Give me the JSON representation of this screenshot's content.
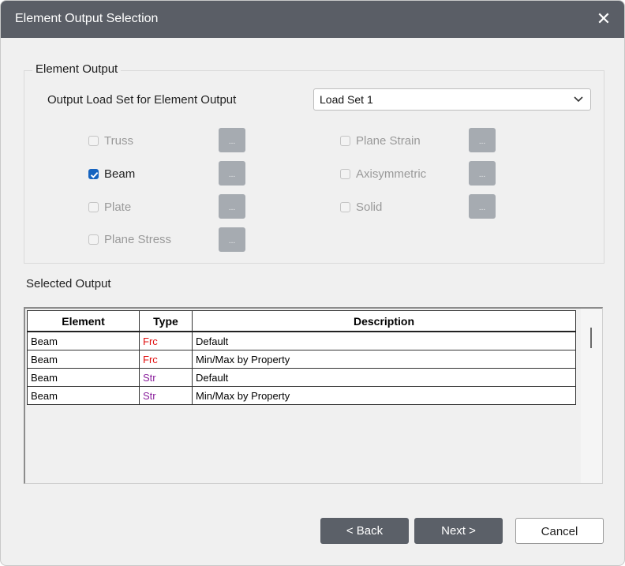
{
  "window": {
    "title": "Element Output Selection",
    "close_glyph": "✕"
  },
  "group": {
    "title": "Element Output",
    "load_set_label": "Output Load Set for Element Output",
    "load_set_value": "Load Set 1"
  },
  "elements": {
    "truss": {
      "label": "Truss",
      "checked": false,
      "enabled": false
    },
    "beam": {
      "label": "Beam",
      "checked": true,
      "enabled": true
    },
    "plate": {
      "label": "Plate",
      "checked": false,
      "enabled": false
    },
    "plane_stress": {
      "label": "Plane Stress",
      "checked": false,
      "enabled": false
    },
    "plane_strain": {
      "label": "Plane Strain",
      "checked": false,
      "enabled": false
    },
    "axisymmetric": {
      "label": "Axisymmetric",
      "checked": false,
      "enabled": false
    },
    "solid": {
      "label": "Solid",
      "checked": false,
      "enabled": false
    }
  },
  "dots_label": "...",
  "selected_output": {
    "label": "Selected Output",
    "columns": [
      "Element",
      "Type",
      "Description"
    ],
    "rows": [
      [
        "Beam",
        "Frc",
        "Default"
      ],
      [
        "Beam",
        "Frc",
        "Min/Max by Property"
      ],
      [
        "Beam",
        "Str",
        "Default"
      ],
      [
        "Beam",
        "Str",
        "Min/Max by Property"
      ]
    ]
  },
  "buttons": {
    "back": "< Back",
    "next": "Next >",
    "cancel": "Cancel"
  },
  "colors": {
    "titlebar": "#5a5e66",
    "checkbox_on": "#1664c0",
    "frc": "#e01010",
    "str": "#8a1f9c"
  }
}
